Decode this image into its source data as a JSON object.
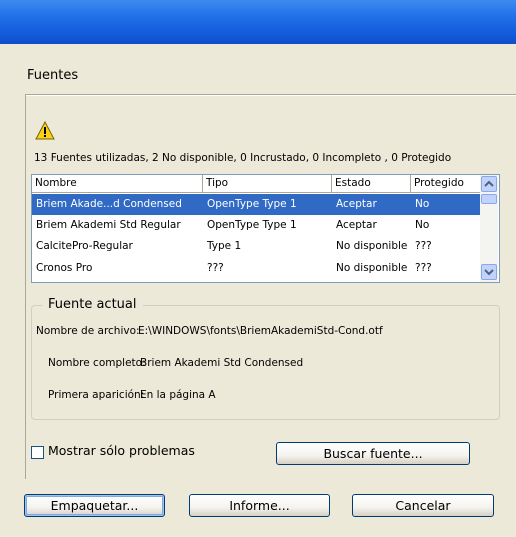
{
  "section": {
    "title": "Fuentes"
  },
  "summary": "13 Fuentes utilizadas, 2 No disponible, 0 Incrustado, 0 Incompleto , 0 Protegido",
  "list": {
    "columns": [
      "Nombre",
      "Tipo",
      "Estado",
      "Protegido"
    ],
    "rows": [
      {
        "name": "Briem Akade...d Condensed",
        "type": "OpenType Type 1",
        "status": "Aceptar",
        "protected": "No"
      },
      {
        "name": "Briem Akademi Std Regular",
        "type": "OpenType Type 1",
        "status": "Aceptar",
        "protected": "No"
      },
      {
        "name": "CalcitePro-Regular",
        "type": "Type 1",
        "status": "No disponible",
        "protected": "???"
      },
      {
        "name": "Cronos Pro",
        "type": "???",
        "status": "No disponible",
        "protected": "???"
      }
    ]
  },
  "current_font": {
    "title": "Fuente actual",
    "file_label": "Nombre de archivo:",
    "file_value": "E:\\WINDOWS\\fonts\\BriemAkademiStd-Cond.otf",
    "full_label": "Nombre completo:",
    "full_value": "Briem Akademi Std Condensed",
    "first_label": "Primera aparición:",
    "first_value": "En la página A"
  },
  "checkbox": {
    "label": "Mostrar sólo problemas",
    "checked": false
  },
  "buttons": {
    "find": "Buscar fuente...",
    "package": "Empaquetar...",
    "report": "Informe...",
    "cancel": "Cancelar"
  },
  "icons": {
    "warning": "warning-icon",
    "scroll_up": "chevron-up-icon",
    "scroll_down": "chevron-down-icon"
  }
}
